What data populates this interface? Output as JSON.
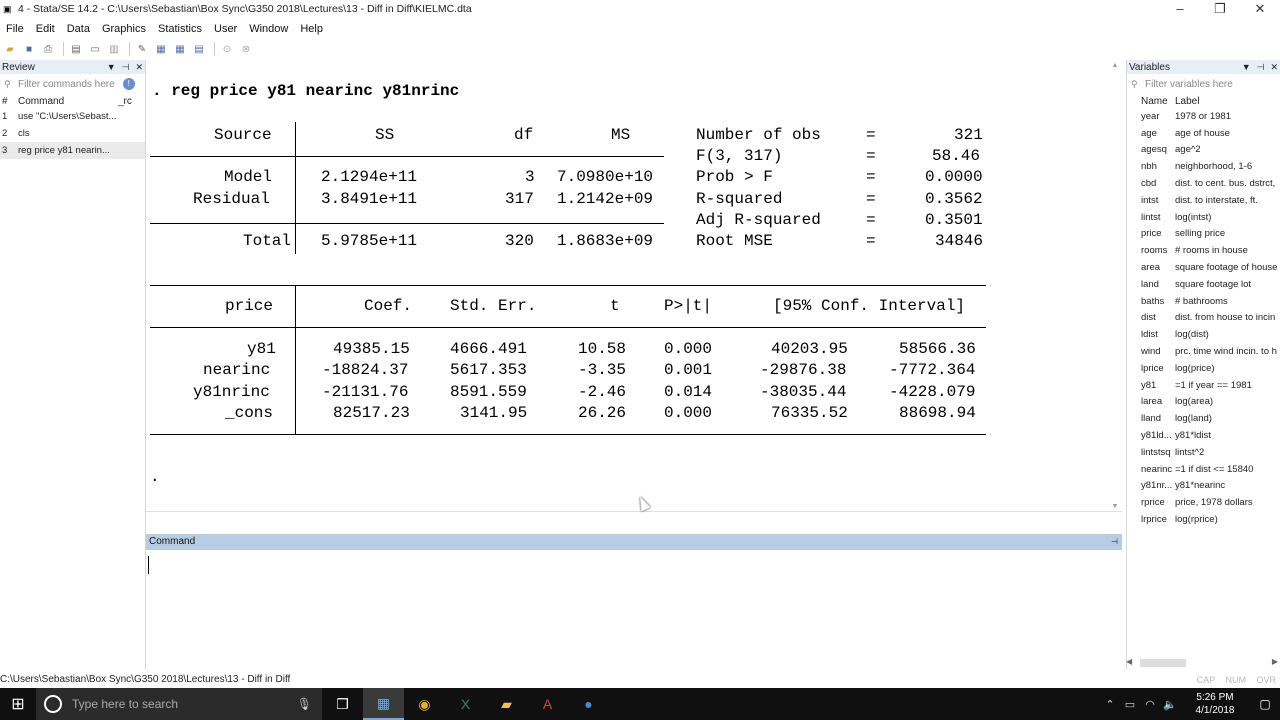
{
  "window": {
    "title": "4 - Stata/SE 14.2 - C:\\Users\\Sebastian\\Box Sync\\G350 2018\\Lectures\\13 - Diff in Diff\\KIELMC.dta",
    "app_icon": "stata-icon"
  },
  "menu": [
    "File",
    "Edit",
    "Data",
    "Graphics",
    "Statistics",
    "User",
    "Window",
    "Help"
  ],
  "review": {
    "title": "Review",
    "filter_placeholder": "Filter commands here",
    "col_command": "Command",
    "col_rc": "_rc",
    "items": [
      {
        "num": "1",
        "cmd": "use \"C:\\Users\\Sebast..."
      },
      {
        "num": "2",
        "cmd": "cls"
      },
      {
        "num": "3",
        "cmd": "reg price y81 nearin..."
      }
    ]
  },
  "results": {
    "command": ". reg price y81 nearinc y81nrinc",
    "anova": {
      "headers": [
        "Source",
        "SS",
        "df",
        "MS"
      ],
      "rows": [
        {
          "source": "Model",
          "ss": "2.1294e+11",
          "df": "3",
          "ms": "7.0980e+10"
        },
        {
          "source": "Residual",
          "ss": "3.8491e+11",
          "df": "317",
          "ms": "1.2142e+09"
        },
        {
          "source": "Total",
          "ss": "5.9785e+11",
          "df": "320",
          "ms": "1.8683e+09"
        }
      ]
    },
    "stats": [
      {
        "label": "Number of obs",
        "eq": "=",
        "value": "321"
      },
      {
        "label": "F(3, 317)",
        "eq": "=",
        "value": "58.46"
      },
      {
        "label": "Prob > F",
        "eq": "=",
        "value": "0.0000"
      },
      {
        "label": "R-squared",
        "eq": "=",
        "value": "0.3562"
      },
      {
        "label": "Adj R-squared",
        "eq": "=",
        "value": "0.3501"
      },
      {
        "label": "Root MSE",
        "eq": "=",
        "value": "34846"
      }
    ],
    "coef_headers": {
      "dep": "price",
      "coef": "Coef.",
      "se": "Std. Err.",
      "t": "t",
      "p": "P>|t|",
      "ci": "[95% Conf. Interval]"
    },
    "coefs": [
      {
        "var": "y81",
        "coef": "49385.15",
        "se": "4666.491",
        "t": "10.58",
        "p": "0.000",
        "lo": "40203.95",
        "hi": "58566.36"
      },
      {
        "var": "nearinc",
        "coef": "-18824.37",
        "se": "5617.353",
        "t": "-3.35",
        "p": "0.001",
        "lo": "-29876.38",
        "hi": "-7772.364"
      },
      {
        "var": "y81nrinc",
        "coef": "-21131.76",
        "se": "8591.559",
        "t": "-2.46",
        "p": "0.014",
        "lo": "-38035.44",
        "hi": "-4228.079"
      },
      {
        "var": "_cons",
        "coef": "82517.23",
        "se": "3141.95",
        "t": "26.26",
        "p": "0.000",
        "lo": "76335.52",
        "hi": "88698.94"
      }
    ],
    "prompt": "."
  },
  "command_pane": {
    "title": "Command"
  },
  "variables": {
    "title": "Variables",
    "filter_placeholder": "Filter variables here",
    "col_name": "Name",
    "col_label": "Label",
    "items": [
      {
        "name": "year",
        "label": "1978 or 1981"
      },
      {
        "name": "age",
        "label": "age of house"
      },
      {
        "name": "agesq",
        "label": "age^2"
      },
      {
        "name": "nbh",
        "label": "neighborhood, 1-6"
      },
      {
        "name": "cbd",
        "label": "dist. to cent. bus. dstrct,"
      },
      {
        "name": "intst",
        "label": "dist. to interstate, ft."
      },
      {
        "name": "lintst",
        "label": "log(intst)"
      },
      {
        "name": "price",
        "label": "selling price"
      },
      {
        "name": "rooms",
        "label": "# rooms in house"
      },
      {
        "name": "area",
        "label": "square footage of house"
      },
      {
        "name": "land",
        "label": "square footage lot"
      },
      {
        "name": "baths",
        "label": "# bathrooms"
      },
      {
        "name": "dist",
        "label": "dist. from house to incin"
      },
      {
        "name": "ldist",
        "label": "log(dist)"
      },
      {
        "name": "wind",
        "label": "prc. time wind incin. to h"
      },
      {
        "name": "lprice",
        "label": "log(price)"
      },
      {
        "name": "y81",
        "label": "=1 if year == 1981"
      },
      {
        "name": "larea",
        "label": "log(area)"
      },
      {
        "name": "lland",
        "label": "log(land)"
      },
      {
        "name": "y81ld...",
        "label": "y81*ldist"
      },
      {
        "name": "lintstsq",
        "label": "lintst^2"
      },
      {
        "name": "nearinc",
        "label": "=1 if dist <= 15840"
      },
      {
        "name": "y81nr...",
        "label": "y81*nearinc"
      },
      {
        "name": "rprice",
        "label": "price, 1978 dollars"
      },
      {
        "name": "lrprice",
        "label": "log(rprice)"
      }
    ]
  },
  "statusbar": {
    "path": "C:\\Users\\Sebastian\\Box Sync\\G350 2018\\Lectures\\13 - Diff in Diff",
    "cap": "CAP",
    "num": "NUM",
    "ovr": "OVR"
  },
  "taskbar": {
    "search_placeholder": "Type here to search",
    "time": "5:26 PM",
    "date": "4/1/2018"
  }
}
